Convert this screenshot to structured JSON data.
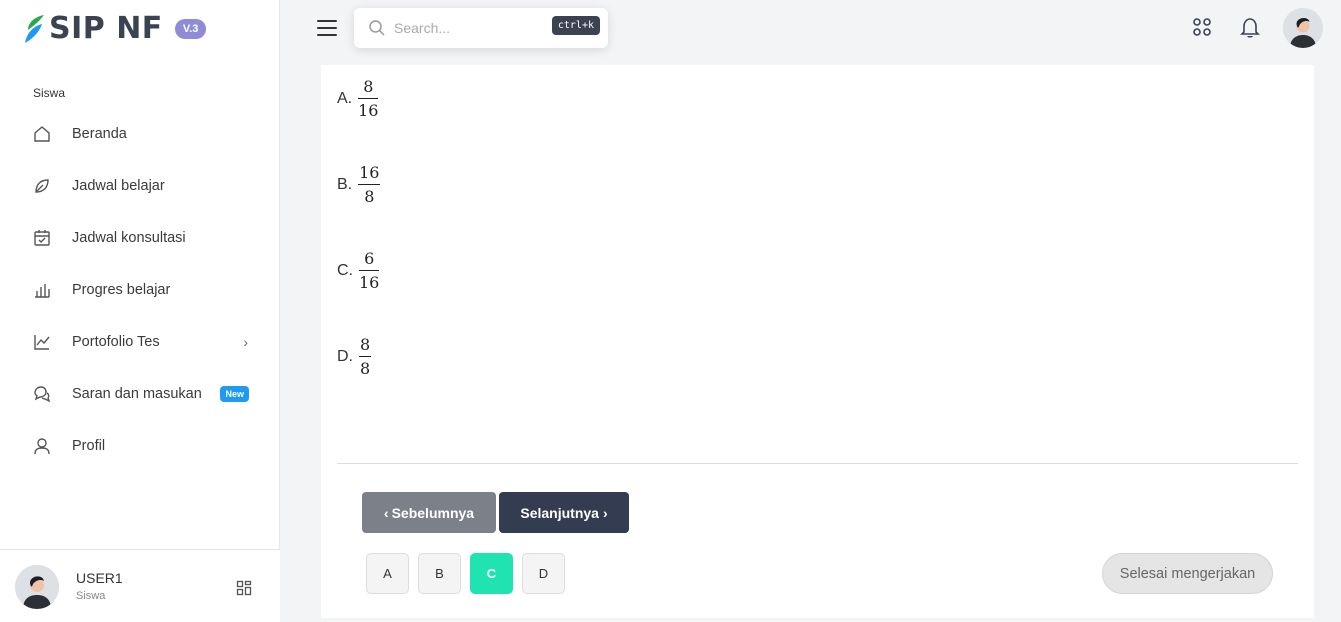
{
  "brand": {
    "name": "SIP NF",
    "version": "V.3"
  },
  "sidebar": {
    "section_label": "Siswa",
    "items": [
      {
        "label": "Beranda",
        "icon": "home-icon"
      },
      {
        "label": "Jadwal belajar",
        "icon": "leaf-icon"
      },
      {
        "label": "Jadwal konsultasi",
        "icon": "calendar-check-icon"
      },
      {
        "label": "Progres belajar",
        "icon": "bar-chart-icon"
      },
      {
        "label": "Portofolio Tes",
        "icon": "line-chart-icon",
        "chevron": "›"
      },
      {
        "label": "Saran dan masukan",
        "icon": "chat-icon",
        "badge": "New"
      },
      {
        "label": "Profil",
        "icon": "user-icon"
      }
    ],
    "user": {
      "name": "USER1",
      "role": "Siswa"
    }
  },
  "topbar": {
    "search_placeholder": "Search...",
    "search_shortcut": "ctrl+k"
  },
  "question": {
    "options": [
      {
        "letter": "A.",
        "numerator": "8",
        "denominator": "16"
      },
      {
        "letter": "B.",
        "numerator": "16",
        "denominator": "8"
      },
      {
        "letter": "C.",
        "numerator": "6",
        "denominator": "16"
      },
      {
        "letter": "D.",
        "numerator": "8",
        "denominator": "8"
      }
    ]
  },
  "nav": {
    "prev_label": "Sebelumnya",
    "next_label": "Selanjutnya",
    "finish_label": "Selesai mengerjakan"
  },
  "answers": [
    {
      "label": "A",
      "selected": false
    },
    {
      "label": "B",
      "selected": false
    },
    {
      "label": "C",
      "selected": true
    },
    {
      "label": "D",
      "selected": false
    }
  ],
  "colors": {
    "accent_selected": "#20e3b2",
    "primary_dark": "#343c52",
    "new_badge": "#1e9bf0",
    "version_badge": "#8f8bd6"
  }
}
